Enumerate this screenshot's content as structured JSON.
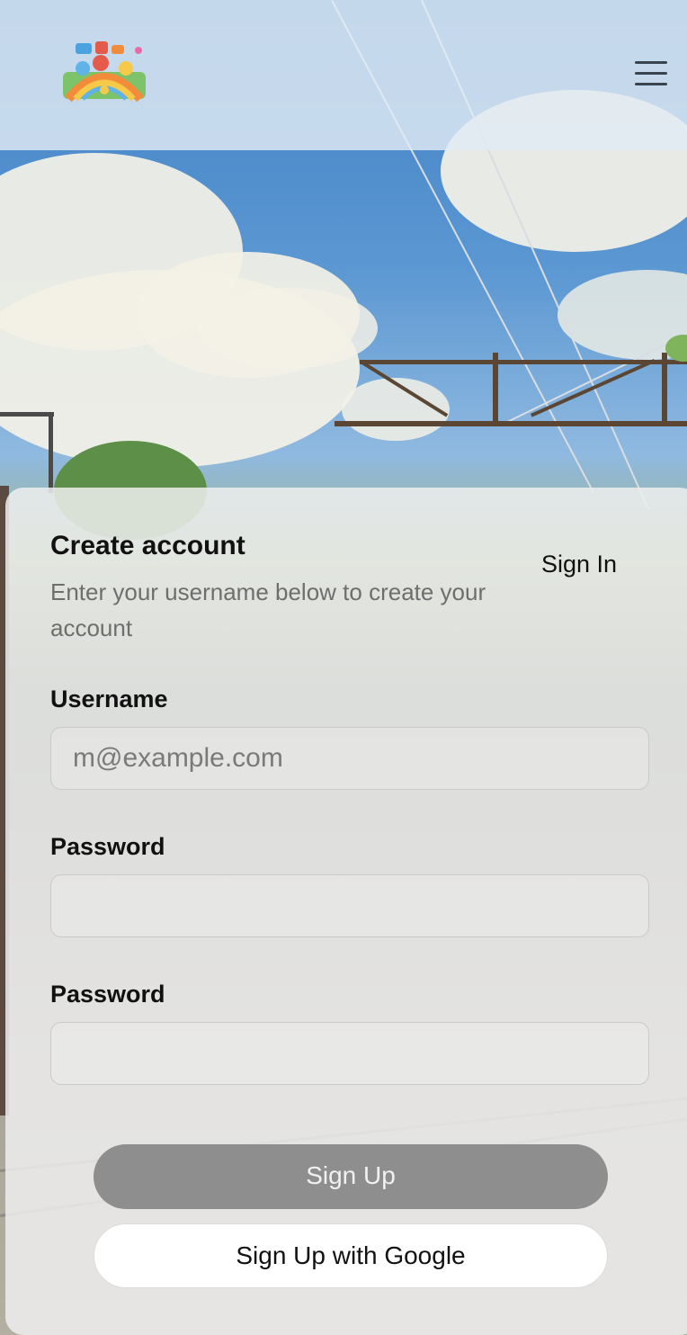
{
  "header": {
    "menu_icon": "hamburger-menu-icon"
  },
  "form": {
    "title": "Create account",
    "subtitle": "Enter your username below to create your account",
    "signin_link": "Sign In",
    "username_label": "Username",
    "username_placeholder": "m@example.com",
    "username_value": "",
    "password_label": "Password",
    "password_value": "",
    "confirm_password_label": "Password",
    "confirm_password_value": "",
    "signup_button": "Sign Up",
    "google_button": "Sign Up with Google"
  },
  "colors": {
    "primary_button_bg": "#8e8e8e",
    "google_button_bg": "#ffffff"
  }
}
